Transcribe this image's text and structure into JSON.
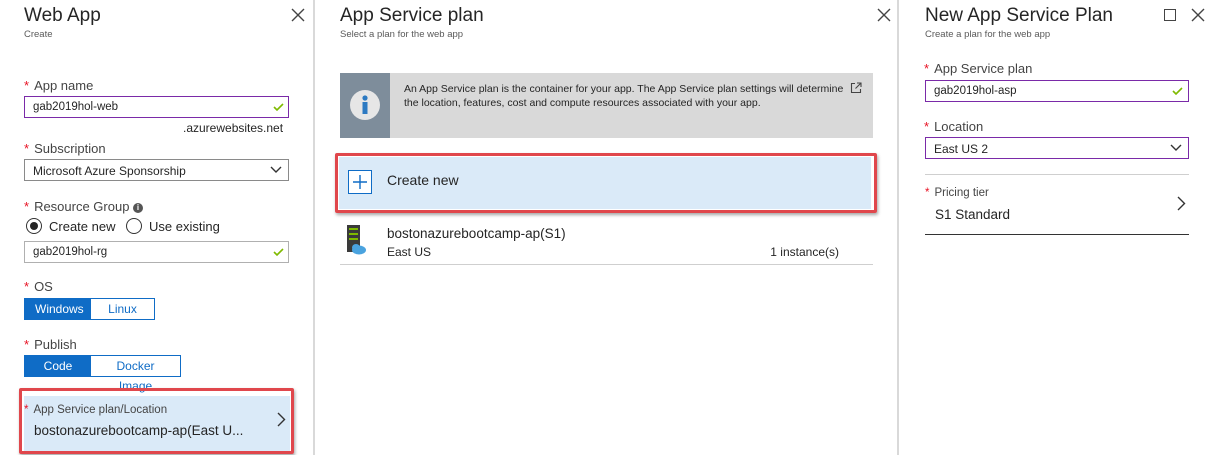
{
  "web_app": {
    "title": "Web App",
    "subtitle": "Create",
    "app_name": {
      "label": "App name",
      "value": "gab2019hol-web",
      "suffix": ".azurewebsites.net"
    },
    "subscription": {
      "label": "Subscription",
      "value": "Microsoft Azure Sponsorship"
    },
    "resource_group": {
      "label": "Resource Group",
      "option_new": "Create new",
      "option_existing": "Use existing",
      "value": "gab2019hol-rg"
    },
    "os": {
      "label": "OS",
      "options": [
        "Windows",
        "Linux"
      ],
      "selected": "Windows"
    },
    "publish": {
      "label": "Publish",
      "options": [
        "Code",
        "Docker Image"
      ],
      "selected": "Code"
    },
    "plan_location": {
      "label": "App Service plan/Location",
      "value": "bostonazurebootcamp-ap(East U..."
    }
  },
  "app_service_plan": {
    "title": "App Service plan",
    "subtitle": "Select a plan for the web app",
    "info_text": "An App Service plan is the container for your app. The App Service plan settings will determine the location, features, cost and compute resources associated with your app.",
    "create_new_label": "Create new",
    "plans": [
      {
        "name": "bostonazurebootcamp-ap(S1)",
        "location": "East US",
        "instances": "1 instance(s)"
      }
    ]
  },
  "new_plan": {
    "title": "New App Service Plan",
    "subtitle": "Create a plan for the web app",
    "plan": {
      "label": "App Service plan",
      "value": "gab2019hol-asp"
    },
    "location": {
      "label": "Location",
      "value": "East US 2"
    },
    "pricing": {
      "label": "Pricing tier",
      "value": "S1 Standard"
    }
  },
  "colors": {
    "accent": "#0f6cc6",
    "highlight": "#e0474c",
    "input_border": "#7a2aa8",
    "valid": "#7fba00",
    "required": "#e81123"
  }
}
